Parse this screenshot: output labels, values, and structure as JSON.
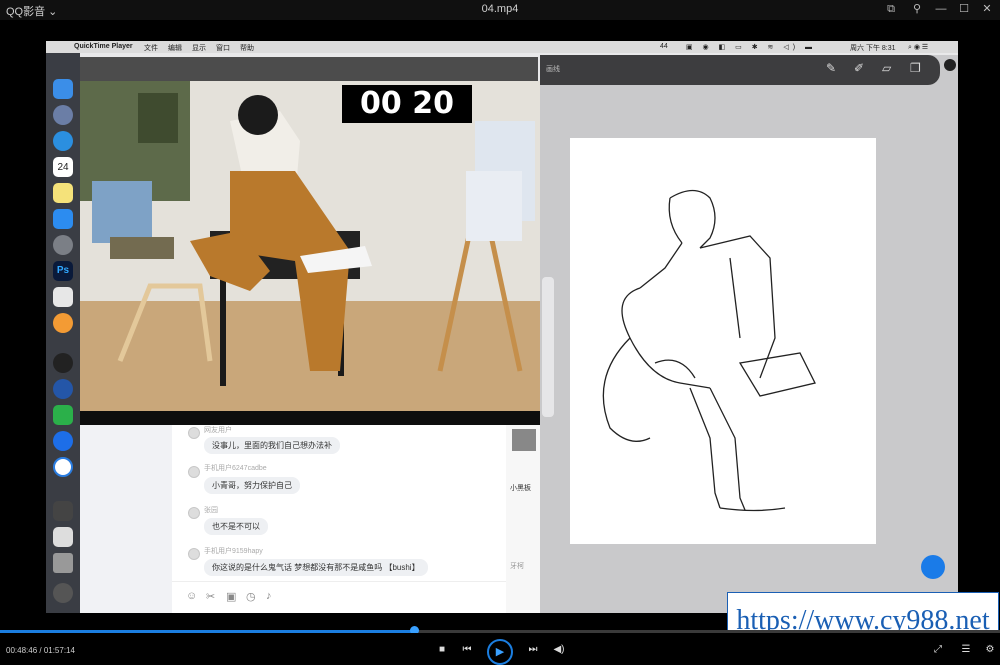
{
  "player": {
    "app_name": "QQ影音",
    "file_name": "04.mp4",
    "time_current": "00:48:46",
    "time_total": "01:57:14",
    "progress": 0.414,
    "accent": "#1b7ee0"
  },
  "mac_menu": {
    "app": "QuickTime Player",
    "items": [
      "文件",
      "编辑",
      "显示",
      "窗口",
      "帮助"
    ],
    "clock": "周六 下午 8:31",
    "badge": "44"
  },
  "dock": {
    "calendar_day": "24",
    "ps_label": "Ps"
  },
  "stream": {
    "timer": "00 20"
  },
  "chat": {
    "messages": [
      {
        "name": "网友用户",
        "text": "没事儿，里面的我们自己想办法补"
      },
      {
        "name": "手机用户6247cadbe",
        "text": "小青哥，努力保护自己"
      },
      {
        "name": "张园",
        "text": "也不是不可以"
      },
      {
        "name": "手机用户9159hapy",
        "text": "你这说的是什么鬼气话 梦想都没有那不是咸鱼吗 【bushi】"
      }
    ],
    "side_label": "小黑板",
    "side_label2": "牙柯"
  },
  "draw_app": {
    "label": "画线"
  },
  "watermark": "https://www.cy988.net"
}
